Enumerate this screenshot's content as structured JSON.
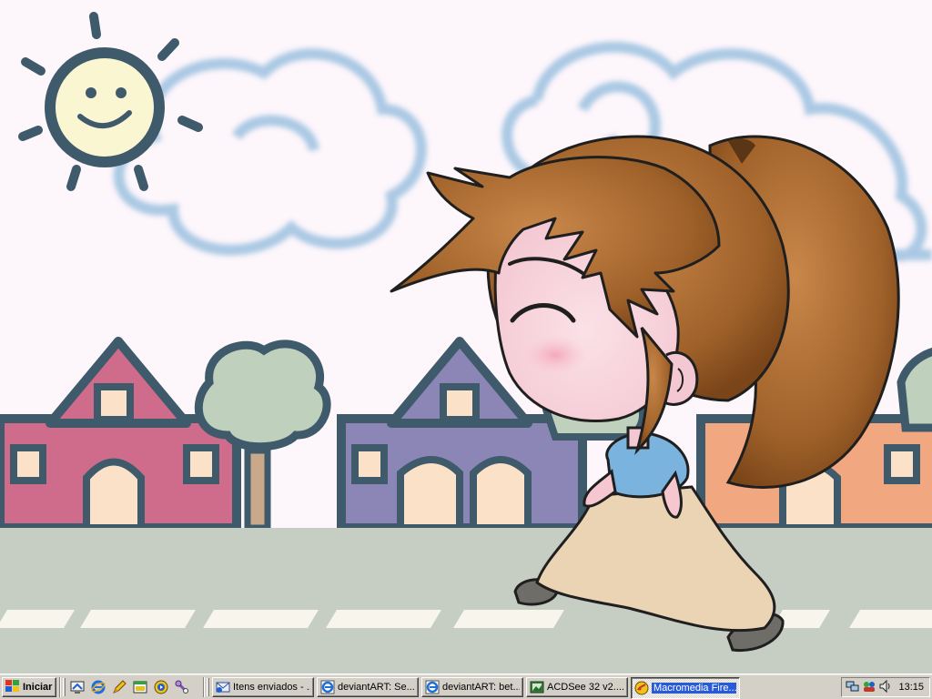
{
  "taskbar": {
    "start_label": "Iniciar",
    "clock": "13:15",
    "quick_launch": [
      {
        "icon": "desktop-icon"
      },
      {
        "icon": "internet-explorer-icon"
      },
      {
        "icon": "pencil-icon"
      },
      {
        "icon": "window-icon"
      },
      {
        "icon": "media-player-icon"
      },
      {
        "icon": "tools-icon"
      }
    ],
    "tasks": [
      {
        "label": "Itens enviados - ...",
        "icon": "outlook-icon",
        "active": false
      },
      {
        "label": "deviantART: Se...",
        "icon": "internet-explorer-icon",
        "active": false
      },
      {
        "label": "deviantART: bet...",
        "icon": "internet-explorer-icon",
        "active": false
      },
      {
        "label": "ACDSee 32 v2....",
        "icon": "acdsee-icon",
        "active": false
      },
      {
        "label": "Macromedia Fire...",
        "icon": "fireworks-icon",
        "active": true
      }
    ],
    "tray_icons": [
      "network-icon",
      "messenger-icon",
      "volume-icon"
    ]
  },
  "colors": {
    "taskbar_bg": "#d4d0c8",
    "active_task_highlight": "#2a5bd7",
    "wallpaper_sky": "#fdf6fb",
    "road": "#c6cdc2",
    "hair": "#a0622a"
  }
}
